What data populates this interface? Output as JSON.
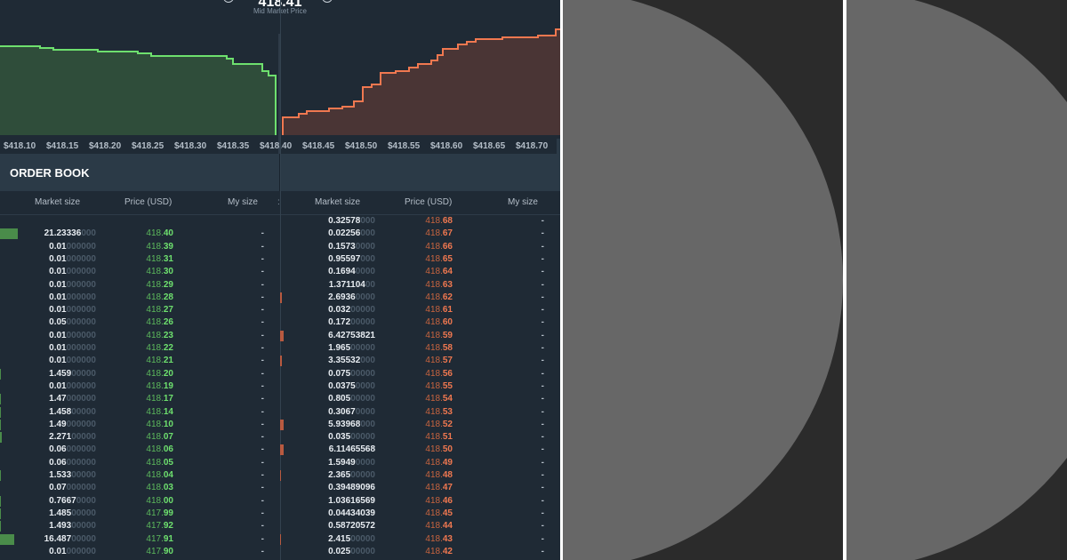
{
  "chart": {
    "mid_price": "418.41",
    "mid_label": "Mid Market Price",
    "x_ticks": [
      "$418.10",
      "$418.15",
      "$418.20",
      "$418.25",
      "$418.30",
      "$418.35",
      "$418.40",
      "$418.45",
      "$418.50",
      "$418.55",
      "$418.60",
      "$418.65",
      "$418.70"
    ],
    "colors": {
      "bid": "#6ee06e",
      "bid_fill": "#2f4d3a",
      "ask": "#f07850",
      "ask_fill": "#4a3535"
    }
  },
  "order_book": {
    "title": "ORDER BOOK",
    "columns": {
      "market_size": "Market size",
      "price": "Price (USD)",
      "my_size": "My size"
    },
    "asks": [
      {
        "size": "0.32578",
        "pad": "000",
        "price": "418.",
        "cents": "68",
        "my": "-"
      },
      {
        "size": "0.02256",
        "pad": "000",
        "price": "418.",
        "cents": "67",
        "my": "-"
      },
      {
        "size": "0.1573",
        "pad": "0000",
        "price": "418.",
        "cents": "66",
        "my": "-"
      },
      {
        "size": "0.95597",
        "pad": "000",
        "price": "418.",
        "cents": "65",
        "my": "-"
      },
      {
        "size": "0.1694",
        "pad": "0000",
        "price": "418.",
        "cents": "64",
        "my": "-"
      },
      {
        "size": "1.371104",
        "pad": "00",
        "price": "418.",
        "cents": "63",
        "my": "-"
      },
      {
        "size": "2.6936",
        "pad": "0000",
        "price": "418.",
        "cents": "62",
        "my": "-"
      },
      {
        "size": "0.032",
        "pad": "00000",
        "price": "418.",
        "cents": "61",
        "my": "-"
      },
      {
        "size": "0.172",
        "pad": "00000",
        "price": "418.",
        "cents": "60",
        "my": "-"
      },
      {
        "size": "6.42753821",
        "pad": "",
        "price": "418.",
        "cents": "59",
        "my": "-"
      },
      {
        "size": "1.965",
        "pad": "00000",
        "price": "418.",
        "cents": "58",
        "my": "-"
      },
      {
        "size": "3.35532",
        "pad": "000",
        "price": "418.",
        "cents": "57",
        "my": "-"
      },
      {
        "size": "0.075",
        "pad": "00000",
        "price": "418.",
        "cents": "56",
        "my": "-"
      },
      {
        "size": "0.0375",
        "pad": "0000",
        "price": "418.",
        "cents": "55",
        "my": "-"
      },
      {
        "size": "0.805",
        "pad": "00000",
        "price": "418.",
        "cents": "54",
        "my": "-"
      },
      {
        "size": "0.3067",
        "pad": "0000",
        "price": "418.",
        "cents": "53",
        "my": "-"
      },
      {
        "size": "5.93968",
        "pad": "000",
        "price": "418.",
        "cents": "52",
        "my": "-"
      },
      {
        "size": "0.035",
        "pad": "00000",
        "price": "418.",
        "cents": "51",
        "my": "-"
      },
      {
        "size": "6.11465568",
        "pad": "",
        "price": "418.",
        "cents": "50",
        "my": "-"
      },
      {
        "size": "1.5949",
        "pad": "0000",
        "price": "418.",
        "cents": "49",
        "my": "-"
      },
      {
        "size": "2.365",
        "pad": "00000",
        "price": "418.",
        "cents": "48",
        "my": "-"
      },
      {
        "size": "0.39489096",
        "pad": "",
        "price": "418.",
        "cents": "47",
        "my": "-"
      },
      {
        "size": "1.03616569",
        "pad": "",
        "price": "418.",
        "cents": "46",
        "my": "-"
      },
      {
        "size": "0.04434039",
        "pad": "",
        "price": "418.",
        "cents": "45",
        "my": "-"
      },
      {
        "size": "0.58720572",
        "pad": "",
        "price": "418.",
        "cents": "44",
        "my": "-"
      },
      {
        "size": "2.415",
        "pad": "00000",
        "price": "418.",
        "cents": "43",
        "my": "-"
      },
      {
        "size": "0.025",
        "pad": "00000",
        "price": "418.",
        "cents": "42",
        "my": "-"
      }
    ],
    "bids": [
      {
        "size": "21.23336",
        "pad": "000",
        "price": "418.",
        "cents": "40",
        "my": "-"
      },
      {
        "size": "0.01",
        "pad": "000000",
        "price": "418.",
        "cents": "39",
        "my": "-"
      },
      {
        "size": "0.01",
        "pad": "000000",
        "price": "418.",
        "cents": "31",
        "my": "-"
      },
      {
        "size": "0.01",
        "pad": "000000",
        "price": "418.",
        "cents": "30",
        "my": "-"
      },
      {
        "size": "0.01",
        "pad": "000000",
        "price": "418.",
        "cents": "29",
        "my": "-"
      },
      {
        "size": "0.01",
        "pad": "000000",
        "price": "418.",
        "cents": "28",
        "my": "-"
      },
      {
        "size": "0.01",
        "pad": "000000",
        "price": "418.",
        "cents": "27",
        "my": "-"
      },
      {
        "size": "0.05",
        "pad": "000000",
        "price": "418.",
        "cents": "26",
        "my": "-"
      },
      {
        "size": "0.01",
        "pad": "000000",
        "price": "418.",
        "cents": "23",
        "my": "-"
      },
      {
        "size": "0.01",
        "pad": "000000",
        "price": "418.",
        "cents": "22",
        "my": "-"
      },
      {
        "size": "0.01",
        "pad": "000000",
        "price": "418.",
        "cents": "21",
        "my": "-"
      },
      {
        "size": "1.459",
        "pad": "00000",
        "price": "418.",
        "cents": "20",
        "my": "-"
      },
      {
        "size": "0.01",
        "pad": "000000",
        "price": "418.",
        "cents": "19",
        "my": "-"
      },
      {
        "size": "1.47",
        "pad": "000000",
        "price": "418.",
        "cents": "17",
        "my": "-"
      },
      {
        "size": "1.458",
        "pad": "00000",
        "price": "418.",
        "cents": "14",
        "my": "-"
      },
      {
        "size": "1.49",
        "pad": "000000",
        "price": "418.",
        "cents": "10",
        "my": "-"
      },
      {
        "size": "2.271",
        "pad": "00000",
        "price": "418.",
        "cents": "07",
        "my": "-"
      },
      {
        "size": "0.06",
        "pad": "000000",
        "price": "418.",
        "cents": "06",
        "my": "-"
      },
      {
        "size": "0.06",
        "pad": "000000",
        "price": "418.",
        "cents": "05",
        "my": "-"
      },
      {
        "size": "1.533",
        "pad": "00000",
        "price": "418.",
        "cents": "04",
        "my": "-"
      },
      {
        "size": "0.07",
        "pad": "000000",
        "price": "418.",
        "cents": "03",
        "my": "-"
      },
      {
        "size": "0.7667",
        "pad": "0000",
        "price": "418.",
        "cents": "00",
        "my": "-"
      },
      {
        "size": "1.485",
        "pad": "00000",
        "price": "417.",
        "cents": "99",
        "my": "-"
      },
      {
        "size": "1.493",
        "pad": "00000",
        "price": "417.",
        "cents": "92",
        "my": "-"
      },
      {
        "size": "16.487",
        "pad": "00000",
        "price": "417.",
        "cents": "91",
        "my": "-"
      },
      {
        "size": "0.01",
        "pad": "000000",
        "price": "417.",
        "cents": "90",
        "my": "-"
      }
    ]
  },
  "panels": {
    "background": "#2b2b2b",
    "shape": "#676767"
  }
}
